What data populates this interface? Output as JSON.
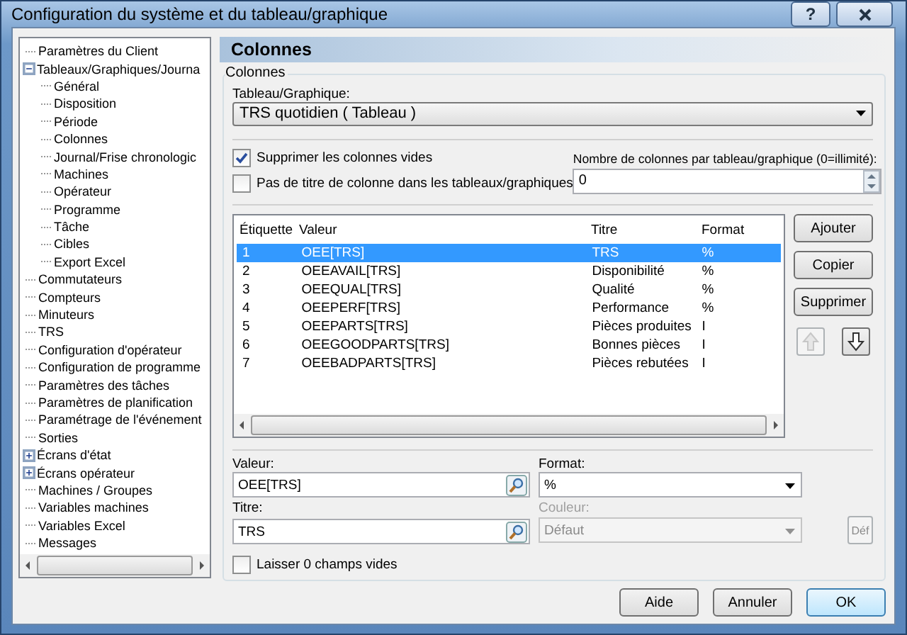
{
  "window": {
    "title": "Configuration du système et du tableau/graphique",
    "help_button": "?"
  },
  "tree": [
    {
      "label": "Paramètres du Client"
    },
    {
      "label": "Tableaux/Graphiques/Journa",
      "expanded": true,
      "children": [
        {
          "label": "Général"
        },
        {
          "label": "Disposition"
        },
        {
          "label": "Période"
        },
        {
          "label": "Colonnes"
        },
        {
          "label": "Journal/Frise chronologic"
        },
        {
          "label": "Machines"
        },
        {
          "label": "Opérateur"
        },
        {
          "label": "Programme"
        },
        {
          "label": "Tâche"
        },
        {
          "label": "Cibles"
        },
        {
          "label": "Export Excel"
        }
      ]
    },
    {
      "label": "Commutateurs"
    },
    {
      "label": "Compteurs"
    },
    {
      "label": "Minuteurs"
    },
    {
      "label": "TRS"
    },
    {
      "label": "Configuration d'opérateur"
    },
    {
      "label": "Configuration de programme"
    },
    {
      "label": "Paramètres des tâches"
    },
    {
      "label": "Paramètres de planification"
    },
    {
      "label": "Paramétrage de l'événement"
    },
    {
      "label": "Sorties"
    },
    {
      "label": "Écrans d'état",
      "expanded": false
    },
    {
      "label": "Écrans opérateur",
      "expanded": false
    },
    {
      "label": "Machines / Groupes"
    },
    {
      "label": "Variables machines"
    },
    {
      "label": "Variables Excel"
    },
    {
      "label": "Messages"
    }
  ],
  "panel": {
    "header": "Colonnes",
    "group": "Colonnes",
    "chart_label": "Tableau/Graphique:",
    "chart_select": "TRS quotidien ( Tableau )",
    "options": [
      {
        "label": "Supprimer les colonnes vides",
        "checked": true
      },
      {
        "label": "Pas de titre de colonne dans les tableaux/graphiques",
        "checked": false
      }
    ],
    "count_label": "Nombre de colonnes par tableau/graphique (0=illimité):",
    "count_value": "0"
  },
  "table": {
    "columns": [
      "Étiquette",
      "Valeur",
      "Titre",
      "Format"
    ],
    "rows": [
      {
        "cells": [
          "1",
          "OEE[TRS]",
          "TRS",
          "%"
        ],
        "selected": true
      },
      {
        "cells": [
          "2",
          "OEEAVAIL[TRS]",
          "Disponibilité",
          "%"
        ],
        "selected": false
      },
      {
        "cells": [
          "3",
          "OEEQUAL[TRS]",
          "Qualité",
          "%"
        ],
        "selected": false
      },
      {
        "cells": [
          "4",
          "OEEPERF[TRS]",
          "Performance",
          "%"
        ],
        "selected": false
      },
      {
        "cells": [
          "5",
          "OEEPARTS[TRS]",
          "Pièces produites",
          "I"
        ],
        "selected": false
      },
      {
        "cells": [
          "6",
          "OEEGOODPARTS[TRS]",
          "Bonnes pièces",
          "I"
        ],
        "selected": false
      },
      {
        "cells": [
          "7",
          "OEEBADPARTS[TRS]",
          "Pièces rebutées",
          "I"
        ],
        "selected": false
      }
    ]
  },
  "side_buttons": [
    "Ajouter",
    "Copier",
    "Supprimer"
  ],
  "move_buttons": [
    {
      "kind": "up",
      "disabled": true
    },
    {
      "kind": "down",
      "disabled": false
    }
  ],
  "form": {
    "value_label": "Valeur:",
    "value": "OEE[TRS]",
    "format_label": "Format:",
    "format": "%",
    "title_label": "Titre:",
    "title": "TRS",
    "color_label": "Couleur:",
    "color_value": "Défaut",
    "color_disabled": true,
    "def_button": "Déf",
    "def_disabled": true,
    "blank_option": {
      "label": "Laisser 0 champs vides",
      "checked": false
    }
  },
  "footer_buttons": [
    {
      "label": "Aide",
      "default": false
    },
    {
      "label": "Annuler",
      "default": false
    },
    {
      "label": "OK",
      "default": true
    }
  ]
}
